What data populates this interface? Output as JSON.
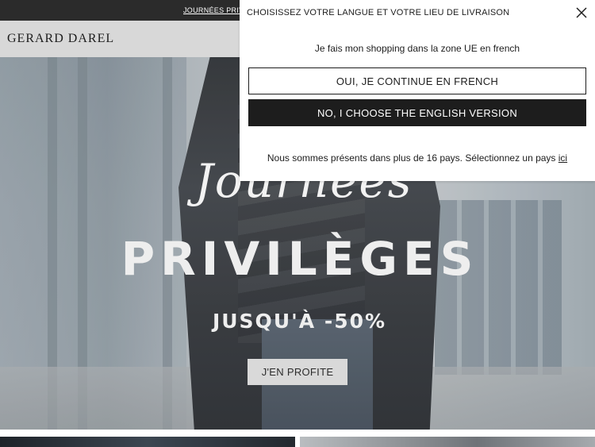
{
  "promo_bar": {
    "link_text": "JOURNÉES PRIV"
  },
  "header": {
    "logo_text": "GERARD DAREL"
  },
  "hero": {
    "script_title": "Journées",
    "main_title": "PRIVILÈGES",
    "subtitle": "JUSQU'À -50%",
    "cta_label": "J'EN PROFITE"
  },
  "language_modal": {
    "title": "CHOISISSEZ VOTRE LANGUE ET VOTRE LIEU DE LIVRAISON",
    "close_icon": "close-icon",
    "info_text": "Je fais mon shopping dans la zone UE en french",
    "continue_french_label": "OUI, JE CONTINUE EN FRENCH",
    "choose_english_label": "NO, I CHOOSE THE ENGLISH VERSION",
    "countries_text": "Nous sommes présents dans plus de 16 pays. Sélectionnez un pays ",
    "countries_link": "ici"
  },
  "colors": {
    "dark": "#1d1d1d",
    "promo_bar_bg": "#2b2b2b",
    "header_bg": "#d8d8d8",
    "cta_bg": "#d9d9d9"
  }
}
